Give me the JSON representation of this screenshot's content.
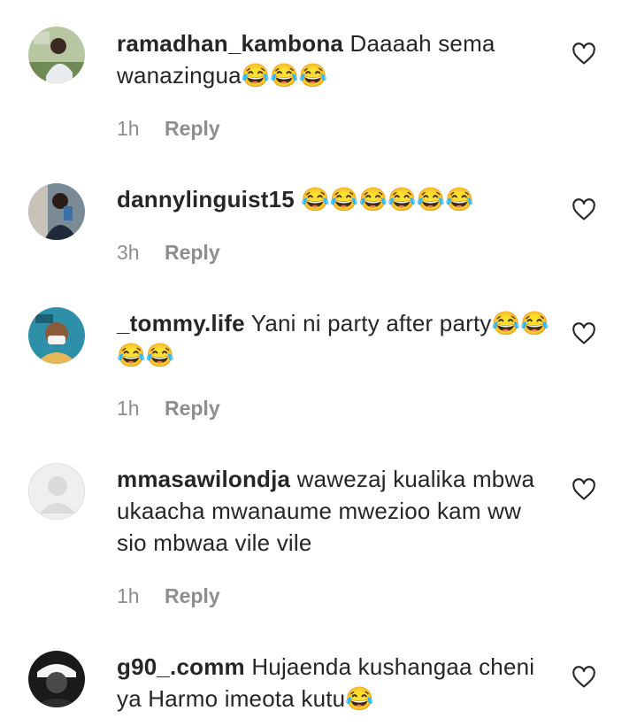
{
  "comments": [
    {
      "username": "ramadhan_kambona",
      "text": "Daaaah sema wanazingua😂😂😂",
      "time": "1h",
      "reply_label": "Reply",
      "avatar_icon": "user-avatar-photo"
    },
    {
      "username": "dannylinguist15",
      "text": "😂😂😂😂😂😂",
      "time": "3h",
      "reply_label": "Reply",
      "avatar_icon": "user-avatar-photo"
    },
    {
      "username": "_tommy.life",
      "text": "Yani ni party after party😂😂😂😂",
      "time": "1h",
      "reply_label": "Reply",
      "avatar_icon": "user-avatar-photo"
    },
    {
      "username": "mmasawilondja",
      "text": "wawezaj kualika mbwa ukaacha mwanaume mwezioo kam ww sio mbwaa vile vile",
      "time": "1h",
      "reply_label": "Reply",
      "avatar_icon": "default-avatar-icon"
    },
    {
      "username": "g90_.comm",
      "text": "Hujaenda kushangaa cheni ya Harmo imeota kutu😂",
      "time": "",
      "reply_label": "",
      "avatar_icon": "user-avatar-photo"
    }
  ],
  "colors": {
    "text": "#262626",
    "meta": "#8e8e8e",
    "background": "#ffffff"
  }
}
